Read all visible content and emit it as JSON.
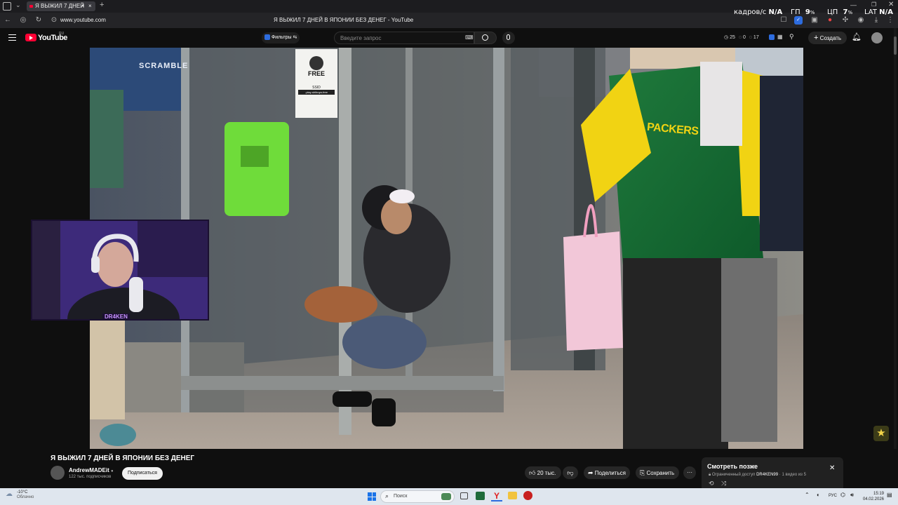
{
  "browser": {
    "tab_title": "Я ВЫЖИЛ 7 ДНЕЙ",
    "url": "www.youtube.com",
    "page_title": "Я ВЫЖИЛ 7 ДНЕЙ В ЯПОНИИ БЕЗ ДЕНЕГ - YouTube"
  },
  "overlay_stats": {
    "fps_label": "кадров/с",
    "fps_value": "N/A",
    "gpu_label": "ГП",
    "gpu_value": "9",
    "cpu_label": "ЦП",
    "cpu_value": "7",
    "lat_label": "LAT",
    "lat_value": "N/A"
  },
  "youtube": {
    "logo_text": "YouTube",
    "region": "RU",
    "filters_label": "Фильтры",
    "search_placeholder": "Введите запрос",
    "counter_a": "25",
    "counter_b": "0",
    "counter_c": "17",
    "create_label": "Создать"
  },
  "video_scene": {
    "sign_text": "FREE",
    "sign_sub": "SSID",
    "sign_ssid": "-play-shibuya-free",
    "jacket_text": "PACKERS",
    "storefront_text": "SCRAMBLE",
    "webcam_tag": "DR4KEN"
  },
  "video_info": {
    "title": "Я ВЫЖИЛ 7 ДНЕЙ В ЯПОНИИ БЕЗ ДЕНЕГ",
    "channel": "AndrewMADEit",
    "subscribers": "122 тыс. подписчиков",
    "subscribe_label": "Подписаться",
    "likes": "20 тыс.",
    "share_label": "Поделиться",
    "save_label": "Сохранить"
  },
  "watch_later": {
    "title": "Смотреть позже",
    "access": "Ограниченный доступ",
    "owner": "DR4KEN99",
    "position": "1 видео из 5"
  },
  "taskbar": {
    "weather_temp": "-10°C",
    "weather_desc": "Облачно",
    "search_label": "Поиск",
    "lang": "РУС",
    "time": "15:19",
    "date": "04.02.2026"
  },
  "colors": {
    "yt_red": "#ff0033",
    "bg": "#0f0f0f",
    "taskbar": "#dfe6ee"
  }
}
